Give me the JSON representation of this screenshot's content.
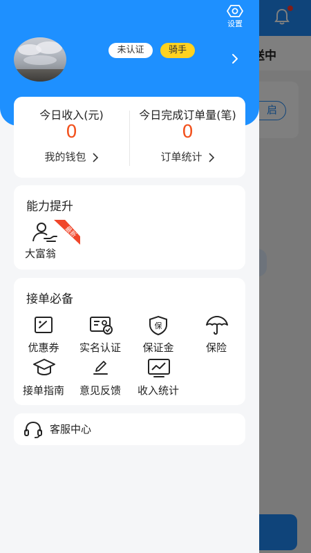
{
  "background": {
    "tab_text": "送中",
    "pill_text": "启"
  },
  "drawer": {
    "settings_label": "设置",
    "badges": {
      "unverified": "未认证",
      "rider": "骑手"
    },
    "stats": {
      "income_title": "今日收入(元)",
      "income_value": "0",
      "wallet_link": "我的钱包",
      "orders_title": "今日完成订单量(笔)",
      "orders_value": "0",
      "orders_link": "订单统计"
    },
    "ability": {
      "title": "能力提升",
      "items": [
        {
          "label": "大富翁",
          "ribbon": "最新",
          "icon": "person-hand-icon"
        }
      ]
    },
    "tools": {
      "title": "接单必备",
      "items": [
        {
          "label": "优惠券",
          "icon": "coupon-icon"
        },
        {
          "label": "实名认证",
          "icon": "id-card-icon"
        },
        {
          "label": "保证金",
          "icon": "deposit-shield-icon",
          "glyph": "保"
        },
        {
          "label": "保险",
          "icon": "umbrella-icon"
        },
        {
          "label": "接单指南",
          "icon": "graduation-cap-icon"
        },
        {
          "label": "意见反馈",
          "icon": "pencil-icon"
        },
        {
          "label": "收入统计",
          "icon": "chart-monitor-icon"
        }
      ]
    },
    "service": {
      "label": "客服中心",
      "icon": "headset-icon"
    }
  },
  "colors": {
    "primary": "#1e90ff",
    "accent_orange": "#f2521e",
    "rider_badge": "#ffd21f",
    "ribbon_red": "#f0462a"
  }
}
